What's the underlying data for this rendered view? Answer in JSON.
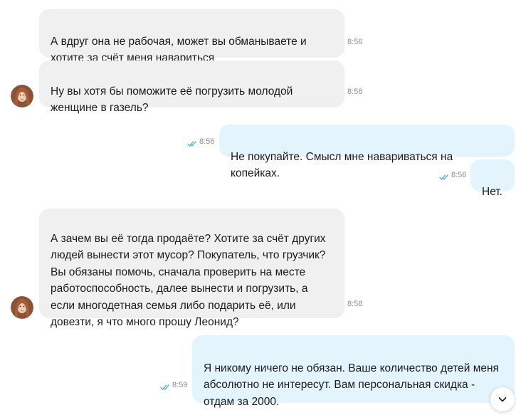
{
  "messages": [
    {
      "direction": "incoming",
      "text": "А вдруг она не рабочая, может вы обманываете и\nхотите за счёт меня навариться",
      "time": "8:56"
    },
    {
      "direction": "incoming",
      "text": "Ну вы хотя бы поможите её погрузить молодой\nженщине в газель?",
      "time": "8:56"
    },
    {
      "direction": "outgoing",
      "text": "Не покупайте. Смысл мне навариваться на копейках.",
      "time": "8:56",
      "status": "read"
    },
    {
      "direction": "outgoing",
      "text": "Нет.",
      "time": "8:56",
      "status": "read"
    },
    {
      "direction": "incoming",
      "text": "А зачем вы её тогда продаёте? Хотите за счёт других\nлюдей вынести этот мусор? Покупатель, что грузчик?\nВы обязаны помочь, сначала проверить на месте\nработоспособность, далее вынести и погрузить, а\nесли многодетная семья либо подарить её, или\nдовезти, я что много прошу Леонид?",
      "time": "8:58"
    },
    {
      "direction": "outgoing",
      "text": "Я никому ничего не обязан. Ваше количество детей меня\nабсолютно не интересут. Вам персональная скидка -\nотдам за 2000.",
      "time": "8:59",
      "status": "read"
    }
  ],
  "colors": {
    "incoming_bubble": "#f0f0f0",
    "outgoing_bubble": "#e3f4fc",
    "read_check": "#4aa3df",
    "timestamp": "#8a8a8a"
  },
  "icons": {
    "read_status": "double-check-icon",
    "avatar": "user-avatar",
    "scroll_down": "chevron-down-icon"
  }
}
